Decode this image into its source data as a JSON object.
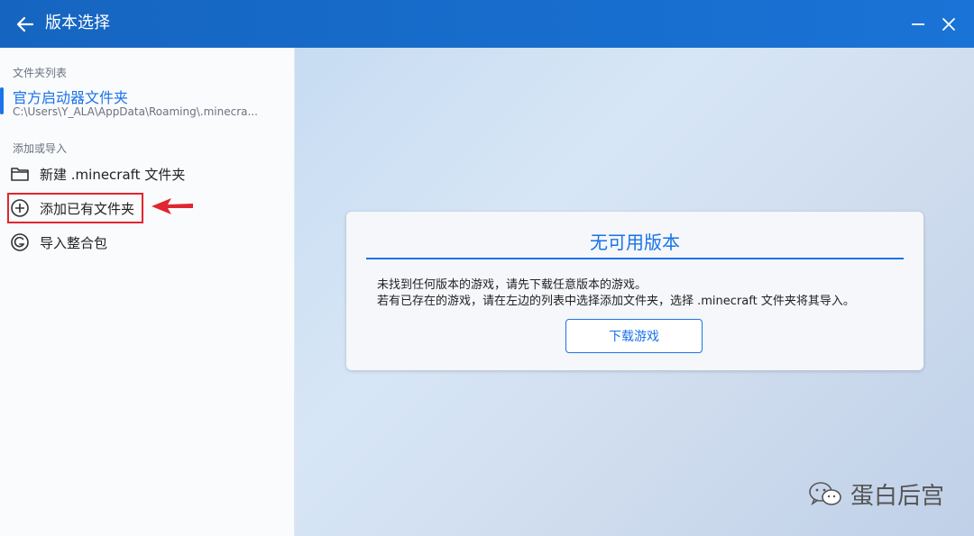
{
  "window": {
    "title": "版本选择",
    "back_icon": "arrow-left-icon",
    "minimize_icon": "minimize-icon",
    "close_icon": "close-icon"
  },
  "sidebar": {
    "folder_section_label": "文件夹列表",
    "folders": [
      {
        "name": "官方启动器文件夹",
        "path": "C:\\Users\\Y_ALA\\AppData\\Roaming\\.minecra..."
      }
    ],
    "add_section_label": "添加或导入",
    "actions": [
      {
        "label": "新建 .minecraft 文件夹",
        "icon": "folder-icon"
      },
      {
        "label": "添加已有文件夹",
        "icon": "plus-circle-icon"
      },
      {
        "label": "导入整合包",
        "icon": "modpack-icon"
      }
    ]
  },
  "main": {
    "card": {
      "title": "无可用版本",
      "line1": "未找到任何版本的游戏，请先下载任意版本的游戏。",
      "line2": "若有已存在的游戏，请在左边的列表中选择添加文件夹，选择 .minecraft 文件夹将其导入。",
      "button_label": "下载游戏"
    }
  },
  "watermark": {
    "text": "蛋白后宫",
    "icon": "wechat-icon"
  },
  "colors": {
    "titlebar": "#1565c0",
    "accent": "#1a73e8",
    "highlight_red": "#e0262f"
  }
}
